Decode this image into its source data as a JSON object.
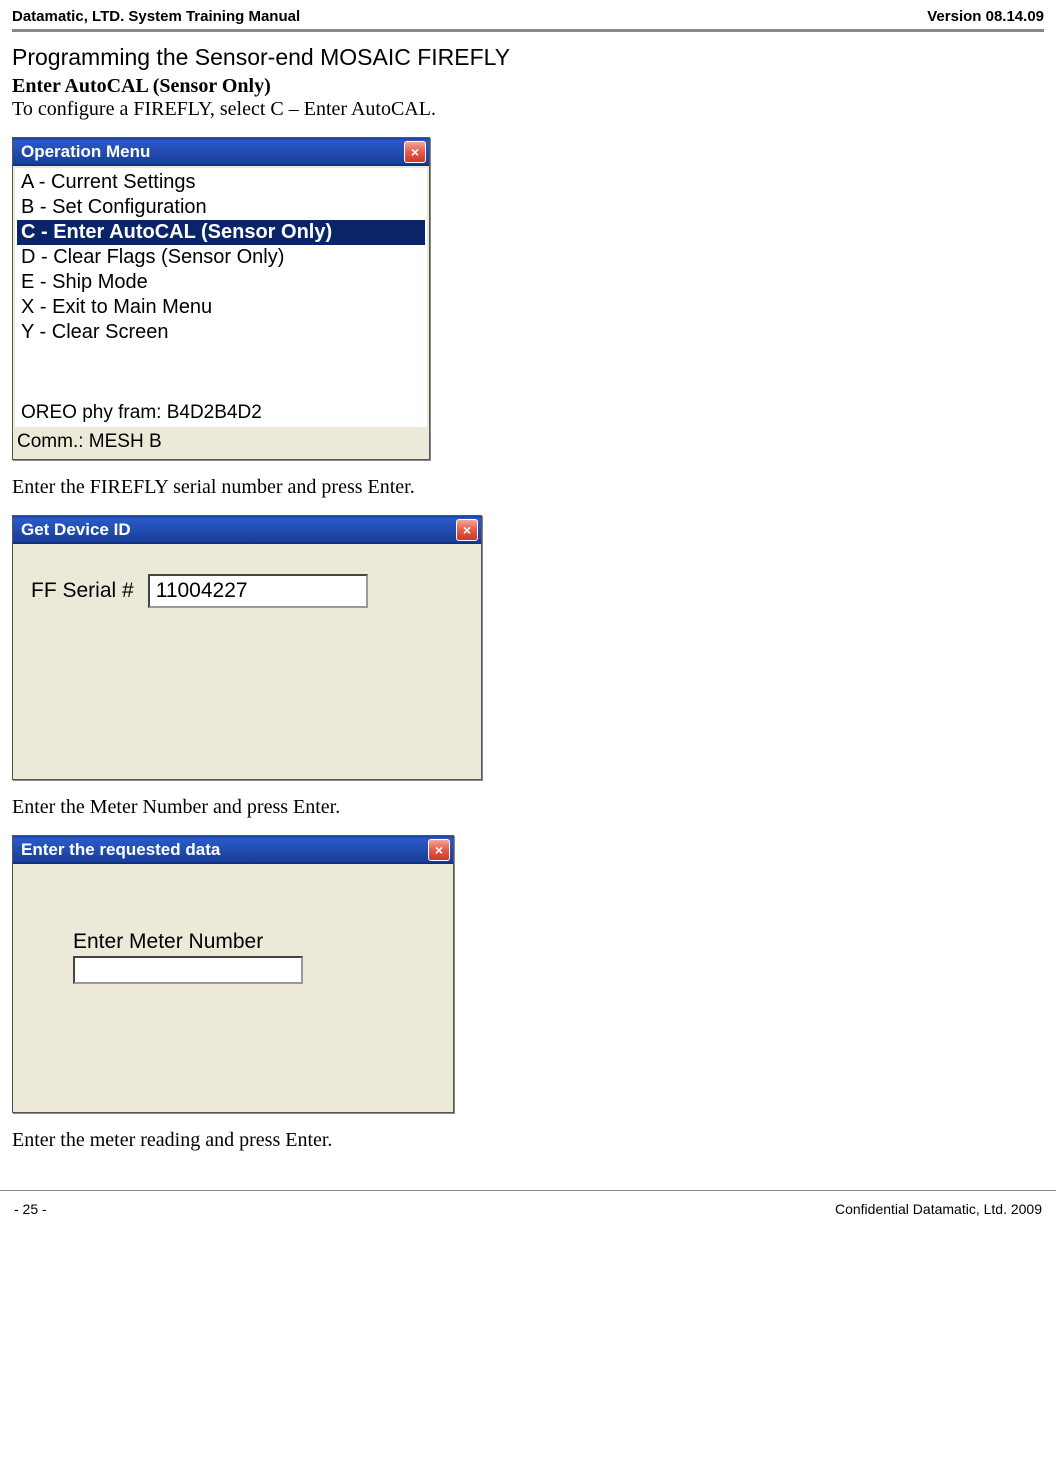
{
  "header": {
    "left": "Datamatic, LTD. System Training  Manual",
    "right": "Version 08.14.09"
  },
  "section": {
    "heading": "Programming the Sensor-end MOSAIC FIREFLY",
    "subheading": "Enter AutoCAL (Sensor Only)",
    "body1": "To configure a  FIREFLY, select C – Enter AutoCAL.",
    "body2": "Enter the FIREFLY serial number and press Enter.",
    "body3": "Enter the Meter Number and press Enter.",
    "body4": "Enter the meter reading and press Enter."
  },
  "dialog1": {
    "title": "Operation Menu",
    "close": "×",
    "items": [
      "A - Current Settings",
      "B - Set Configuration",
      "C - Enter AutoCAL (Sensor Only)",
      "D - Clear Flags (Sensor Only)",
      "E - Ship Mode",
      "X - Exit to Main Menu",
      "Y - Clear Screen"
    ],
    "footer1": "OREO phy fram: B4D2B4D2",
    "footer2": "Comm.: MESH  B"
  },
  "dialog2": {
    "title": "Get Device ID",
    "close": "×",
    "label": "FF Serial #",
    "value": "11004227"
  },
  "dialog3": {
    "title": "Enter the requested data",
    "close": "×",
    "label": "Enter Meter Number",
    "value": ""
  },
  "footer": {
    "left": "- 25 -",
    "right": "Confidential Datamatic, Ltd. 2009"
  }
}
